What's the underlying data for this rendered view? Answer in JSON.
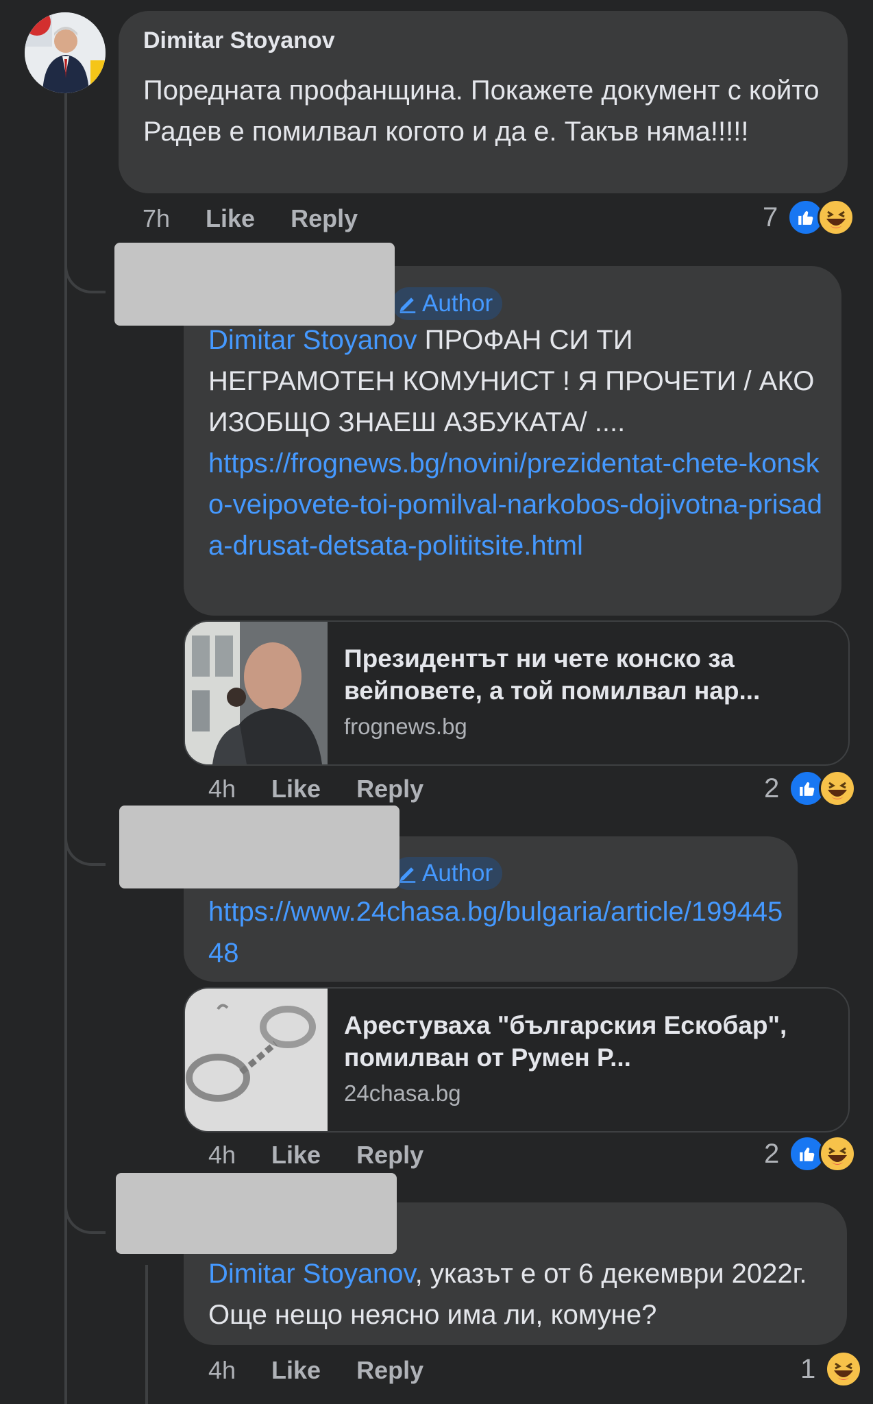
{
  "comments": [
    {
      "author": "Dimitar Stoyanov",
      "text": "Поредната профанщина. Покажете документ с който Радев е помилвал когото и да е. Такъв няма!!!!!",
      "time": "7h",
      "like_label": "Like",
      "reply_label": "Reply",
      "reaction_count": "7"
    }
  ],
  "replies": [
    {
      "badge": "Author",
      "mention": "Dimitar Stoyanov",
      "text": " ПРОФАН СИ ТИ НЕГРАМОТЕН КОМУНИСТ ! Я ПРОЧЕТИ  / АКО ИЗОБЩО ЗНАЕШ АЗБУКАТА/ ....",
      "link": "https://frognews.bg/novini/prezidentat-chete-konsko-veipovete-toi-pomilval-narkobos-dojivotna-prisada-drusat-detsata-polititsite.html",
      "card_title": "Президентът ни чете конско за вейповете, а той помилвал нар...",
      "card_domain": "frognews.bg",
      "time": "4h",
      "like_label": "Like",
      "reply_label": "Reply",
      "reaction_count": "2"
    },
    {
      "badge": "Author",
      "link": "https://www.24chasa.bg/bulgaria/article/19944548",
      "card_title": "Арестуваха \"българския Ескобар\", помилван от Румен Р...",
      "card_domain": "24chasa.bg",
      "time": "4h",
      "like_label": "Like",
      "reply_label": "Reply",
      "reaction_count": "2"
    },
    {
      "mention": "Dimitar Stoyanov",
      "text": ", указът е от 6 декември 2022г. Още нещо неясно има ли, комуне?",
      "time": "4h",
      "like_label": "Like",
      "reply_label": "Reply",
      "reaction_count": "1"
    }
  ],
  "colors": {
    "background": "#242526",
    "bubble": "#3a3b3c",
    "link": "#4599ff",
    "like": "#1877f2",
    "haha": "#f7c24a"
  },
  "icons": [
    "like-icon",
    "haha-icon",
    "pencil-icon",
    "avatar"
  ]
}
